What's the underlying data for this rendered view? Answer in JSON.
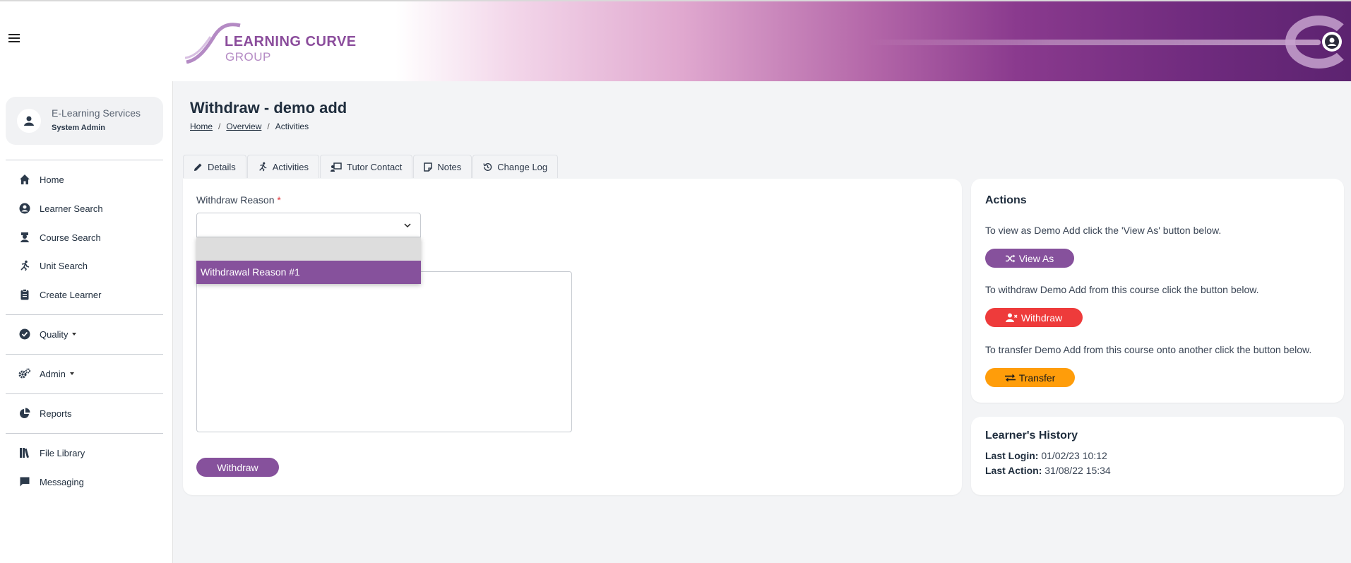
{
  "header": {
    "logo_line1": "LEARNING CURVE",
    "logo_line2": "GROUP",
    "brand_color": "#6e2a7d"
  },
  "sidebar": {
    "user_name": "E-Learning Services",
    "user_role": "System Admin",
    "items": [
      {
        "label": "Home",
        "icon": "home-icon"
      },
      {
        "label": "Learner Search",
        "icon": "user-circle-icon"
      },
      {
        "label": "Course Search",
        "icon": "graduate-icon"
      },
      {
        "label": "Unit Search",
        "icon": "runner-icon"
      },
      {
        "label": "Create Learner",
        "icon": "clipboard-icon"
      },
      {
        "label": "Quality",
        "icon": "check-circle-icon"
      },
      {
        "label": "Admin",
        "icon": "gears-icon"
      },
      {
        "label": "Reports",
        "icon": "pie-chart-icon"
      },
      {
        "label": "File Library",
        "icon": "books-icon"
      },
      {
        "label": "Messaging",
        "icon": "message-icon"
      }
    ]
  },
  "page": {
    "title": "Withdraw - demo add",
    "breadcrumb": [
      "Home",
      "Overview",
      "Activities"
    ],
    "breadcrumb_sep": "/"
  },
  "tabs": [
    {
      "label": "Details",
      "icon": "pencil-icon"
    },
    {
      "label": "Activities",
      "icon": "runner-icon"
    },
    {
      "label": "Tutor Contact",
      "icon": "chalkboard-icon"
    },
    {
      "label": "Notes",
      "icon": "note-icon"
    },
    {
      "label": "Change Log",
      "icon": "history-icon"
    }
  ],
  "form": {
    "reason_label": "Withdraw Reason",
    "required_mark": "*",
    "select_value": "",
    "options": [
      "",
      "Withdrawal Reason #1"
    ],
    "submit_label": "Withdraw",
    "accent": "#86519c"
  },
  "actions": {
    "title": "Actions",
    "view_as_text": "To view as Demo Add click the 'View As' button below.",
    "view_as_label": "View As",
    "withdraw_text": "To withdraw Demo Add from this course click the button below.",
    "withdraw_label": "Withdraw",
    "transfer_text": "To transfer Demo Add from this course onto another click the button below.",
    "transfer_label": "Transfer",
    "colors": {
      "view_as": "#86519c",
      "withdraw": "#ee3b3b",
      "transfer": "#ff9d0a"
    }
  },
  "history": {
    "title": "Learner's History",
    "last_login_label": "Last Login:",
    "last_login_value": "01/02/23 10:12",
    "last_action_label": "Last Action:",
    "last_action_value": "31/08/22 15:34"
  }
}
